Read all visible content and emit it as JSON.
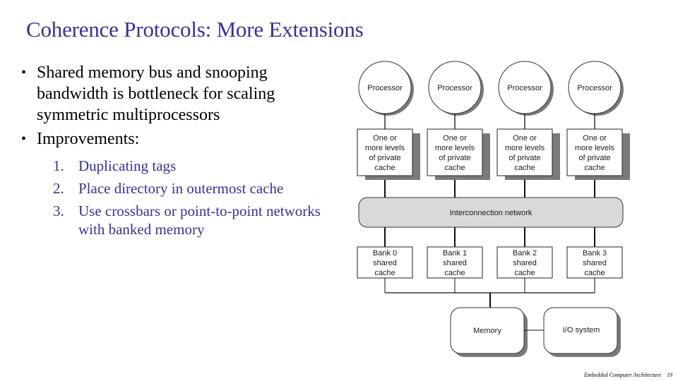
{
  "slide": {
    "title": "Coherence Protocols:  More Extensions",
    "bullets": [
      {
        "text": "Shared memory bus and snooping bandwidth is bottleneck for scaling symmetric multiprocessors"
      },
      {
        "text": "Improvements:"
      }
    ],
    "improvements": [
      {
        "num": "1.",
        "text": "Duplicating tags"
      },
      {
        "num": "2.",
        "text": "Place directory in outermost cache"
      },
      {
        "num": "3.",
        "text": "Use crossbars or point-to-point networks with banked memory"
      }
    ],
    "bullet_glyph": "•",
    "colors": {
      "title": "#33339a",
      "list": "#33339a",
      "network_fill": "#d9d9d9",
      "shadow": "#7a7a7a"
    }
  },
  "diagram": {
    "processors": [
      {
        "label": "Processor",
        "cache": [
          "One or",
          "more levels",
          "of private",
          "cache"
        ]
      },
      {
        "label": "Processor",
        "cache": [
          "One or",
          "more levels",
          "of private",
          "cache"
        ]
      },
      {
        "label": "Processor",
        "cache": [
          "One or",
          "more levels",
          "of private",
          "cache"
        ]
      },
      {
        "label": "Processor",
        "cache": [
          "One or",
          "more levels",
          "of private",
          "cache"
        ]
      }
    ],
    "network": "Interconnection network",
    "banks": [
      [
        "Bank 0",
        "shared",
        "cache"
      ],
      [
        "Bank 1",
        "shared",
        "cache"
      ],
      [
        "Bank 2",
        "shared",
        "cache"
      ],
      [
        "Bank 3",
        "shared",
        "cache"
      ]
    ],
    "memory": "Memory",
    "io": "I/O system"
  },
  "footer": {
    "course": "Embedded Computer Architecture",
    "page": "19"
  }
}
